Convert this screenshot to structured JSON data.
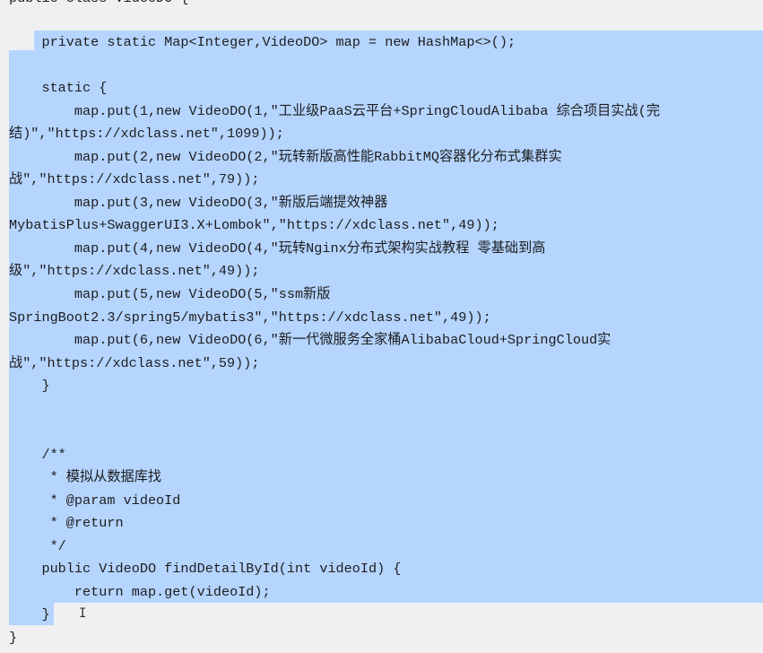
{
  "editor": {
    "lines": [
      "public class VideoDO {",
      "",
      "    private static Map<Integer,VideoDO> map = new HashMap<>();",
      "",
      "    static {",
      "        map.put(1,new VideoDO(1,\"工业级PaaS云平台+SpringCloudAlibaba 综合项目实战(完",
      "结)\",\"https://xdclass.net\",1099));",
      "        map.put(2,new VideoDO(2,\"玩转新版高性能RabbitMQ容器化分布式集群实",
      "战\",\"https://xdclass.net\",79));",
      "        map.put(3,new VideoDO(3,\"新版后端提效神器",
      "MybatisPlus+SwaggerUI3.X+Lombok\",\"https://xdclass.net\",49));",
      "        map.put(4,new VideoDO(4,\"玩转Nginx分布式架构实战教程 零基础到高",
      "级\",\"https://xdclass.net\",49));",
      "        map.put(5,new VideoDO(5,\"ssm新版",
      "SpringBoot2.3/spring5/mybatis3\",\"https://xdclass.net\",49));",
      "        map.put(6,new VideoDO(6,\"新一代微服务全家桶AlibabaCloud+SpringCloud实",
      "战\",\"https://xdclass.net\",59));",
      "    }",
      "",
      "",
      "    /**",
      "     * 模拟从数据库找",
      "     * @param videoId",
      "     * @return",
      "     */",
      "    public VideoDO findDetailById(int videoId) {",
      "        return map.get(videoId);",
      "    }",
      "}"
    ],
    "cursor_glyph": "I"
  }
}
